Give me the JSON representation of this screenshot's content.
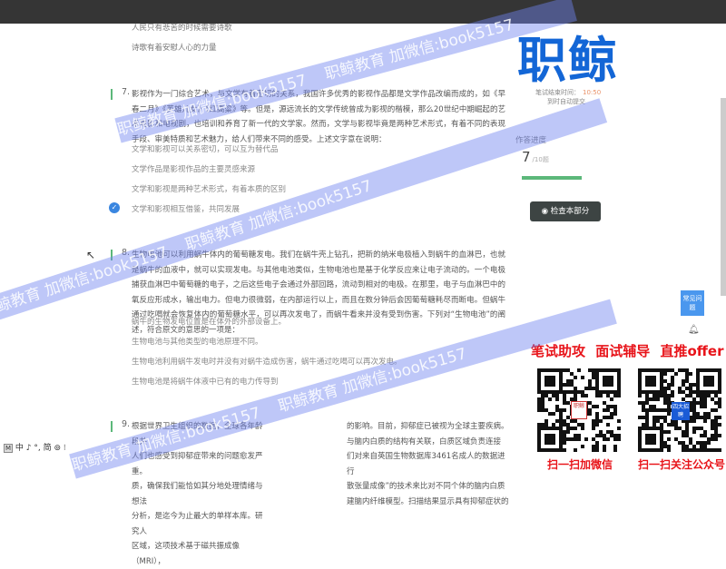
{
  "prev_options": [
    "人民只有悲苦的时候需要诗歌",
    "诗歌有着安慰人心的力量"
  ],
  "questions": [
    {
      "number": "7.",
      "stem": "影视作为一门综合艺术，与文学有着密切的关系，我国许多优秀的影视作品都是文学作品改编而成的，如《早春二月》《英雄儿女》《红高粱》等。但是，源远流长的文学传统曾成为影视的楷模，那么20世纪中期崛起的艺术电影和电视剧，也培训和养育了新一代的文学家。然而，文学与影视毕竟是两种艺术形式，有着不同的表现手段、审美特质和艺术魅力，给人们带来不同的感受。上述文字意在说明：",
      "options": [
        "文学和影视可以关系密切，可以互为替代品",
        "文学作品是影视作品的主要灵感来源",
        "文学和影视是两种艺术形式，有着本质的区别",
        "文学和影视相互借鉴，共同发展"
      ]
    },
    {
      "number": "8.",
      "stem": "生物电池可以利用蜗牛体内的葡萄糖发电。我们在蜗牛壳上钻孔，把新的纳米电极植入到蜗牛的血淋巴，也就是蜗牛的血液中，就可以实现发电。与其他电池类似，生物电池也是基于化学反应来让电子流动的。一个电极捕获血淋巴中葡萄糖的电子，之后这些电子会通过外部回路，流动到相对的电极。在那里，电子与血淋巴中的氧反应形成水，输出电力。但电力很微弱，在内部运行以上，而且在数分钟后会因葡萄糖耗尽而断电。但蜗牛通过吃喝就会恢复体内的葡萄糖水平，可以再次发电了，而蜗牛看来并没有受到伤害。下列对“生物电池”的阐述，符合原文的意思的一项是：",
      "options": [
        "蜗牛的生物发电位置是在体外的外部设备上。",
        "生物电池与其他类型的电池原理不同。",
        "生物电池利用蜗牛发电时并没有对蜗牛造成伤害，蜗牛通过吃喝可以再次发电。",
        "生物电池是将蜗牛体液中已有的电力传导到"
      ]
    },
    {
      "number": "9.",
      "left_lines": [
        "根据世界卫生组织的数据，全球各年龄段共",
        "人们也感受到抑郁症带来的问题愈发严重。",
        "质，确保我们能恰如其分地处理情绪与想法",
        "分析，是迄今为止最大的单样本库。研究人",
        "区域，这项技术基于磁共振成像（MRI），"
      ],
      "right_lines": [
        "的影响。目前，抑郁症已被视为全球主要疾病。",
        "与脑内白质的结构有关联，白质区域负责连接",
        "们对来自英国生物数据库3461名成人的数据进行",
        "散张量成像”的技术来比对不同个体的脑内白质",
        "建脑内纤维模型。扫描结果显示具有抑郁症状的"
      ]
    }
  ],
  "watermark": "职鲸教育 加微信:book5157",
  "panel": {
    "logo": "职鲸",
    "timer_label": "笔试结束时间：",
    "timer_value": "10:50",
    "auto_submit": "到时自动提交",
    "progress_label": "作答进度",
    "progress_done": "7",
    "progress_total": "/10题",
    "progress_fraction": 0.7,
    "check_button": "检查本部分",
    "faq": "常见问题",
    "promo": "笔试助攻 面试辅导 直推offer",
    "qr1_label": "扫一扫加微信",
    "qr1_badge": "职鲸",
    "qr2_label": "扫一扫关注公众号",
    "qr2_badge": "四大招聘"
  },
  "ime": {
    "mode": "M",
    "chars": "中 ♪ °, 简 ⊚ ⁝"
  },
  "colors": {
    "accent": "#1366d6",
    "green": "#5cb87a",
    "red": "#e8141a",
    "check": "#3a86e0"
  }
}
